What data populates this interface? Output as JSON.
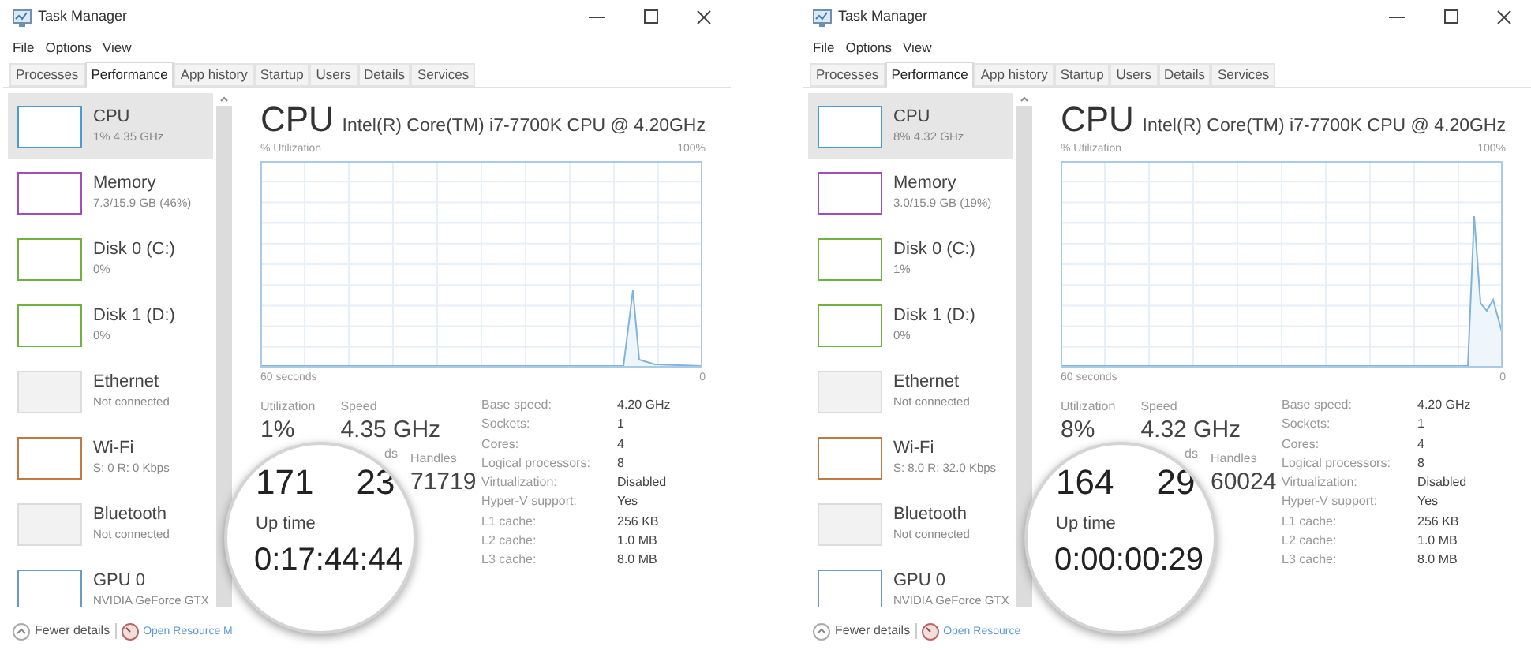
{
  "windows": [
    {
      "title": "Task Manager",
      "menu": [
        "File",
        "Options",
        "View"
      ],
      "tabs": [
        {
          "label": "Processes",
          "selected": false
        },
        {
          "label": "Performance",
          "selected": true
        },
        {
          "label": "App history",
          "selected": false
        },
        {
          "label": "Startup",
          "selected": false
        },
        {
          "label": "Users",
          "selected": false
        },
        {
          "label": "Details",
          "selected": false
        },
        {
          "label": "Services",
          "selected": false
        }
      ],
      "sidebar": [
        {
          "name": "CPU",
          "detail": "1% 4.35 GHz",
          "color": "#4a9ad6",
          "selected": true,
          "connected": true
        },
        {
          "name": "Memory",
          "detail": "7.3/15.9 GB (46%)",
          "color": "#a34db8",
          "selected": false,
          "connected": true
        },
        {
          "name": "Disk 0 (C:)",
          "detail": "0%",
          "color": "#6fb33e",
          "selected": false,
          "connected": true
        },
        {
          "name": "Disk 1 (D:)",
          "detail": "0%",
          "color": "#6fb33e",
          "selected": false,
          "connected": true
        },
        {
          "name": "Ethernet",
          "detail": "Not connected",
          "color": "#dcdcdc",
          "selected": false,
          "connected": false
        },
        {
          "name": "Wi-Fi",
          "detail": "S: 0 R: 0 Kbps",
          "color": "#c07a42",
          "selected": false,
          "connected": true
        },
        {
          "name": "Bluetooth",
          "detail": "Not connected",
          "color": "#dcdcdc",
          "selected": false,
          "connected": false
        },
        {
          "name": "GPU 0",
          "detail": "NVIDIA GeForce GTX",
          "color": "#6a9bc4",
          "selected": false,
          "connected": true
        }
      ],
      "header": {
        "title": "CPU",
        "model": "Intel(R) Core(TM) i7-7700K CPU @ 4.20GHz"
      },
      "graph": {
        "y_label": "% Utilization",
        "y_max": "100%",
        "x_start": "60 seconds",
        "x_end": "0"
      },
      "stats": [
        {
          "label": "Utilization",
          "value": "1%"
        },
        {
          "label": "Speed",
          "value": "4.35 GHz"
        }
      ],
      "threads_label": "ds",
      "handles": {
        "label": "Handles",
        "value": "71719"
      },
      "specs": [
        {
          "label": "Base speed:",
          "value": "4.20 GHz"
        },
        {
          "label": "Sockets:",
          "value": "1"
        },
        {
          "label": "Cores:",
          "value": "4"
        },
        {
          "label": "Logical processors:",
          "value": "8"
        },
        {
          "label": "Virtualization:",
          "value": "Disabled"
        },
        {
          "label": "Hyper-V support:",
          "value": "Yes"
        },
        {
          "label": "L1 cache:",
          "value": "256 KB"
        },
        {
          "label": "L2 cache:",
          "value": "1.0 MB"
        },
        {
          "label": "L3 cache:",
          "value": "8.0 MB"
        }
      ],
      "magnifier": {
        "processes": "171",
        "threads": "23",
        "label": "Up time",
        "value": "0:17:44:44"
      },
      "footer": {
        "fewer_details": "Fewer details",
        "resource_monitor": "Open Resource M"
      }
    },
    {
      "title": "Task Manager",
      "menu": [
        "File",
        "Options",
        "View"
      ],
      "tabs": [
        {
          "label": "Processes",
          "selected": false
        },
        {
          "label": "Performance",
          "selected": true
        },
        {
          "label": "App history",
          "selected": false
        },
        {
          "label": "Startup",
          "selected": false
        },
        {
          "label": "Users",
          "selected": false
        },
        {
          "label": "Details",
          "selected": false
        },
        {
          "label": "Services",
          "selected": false
        }
      ],
      "sidebar": [
        {
          "name": "CPU",
          "detail": "8% 4.32 GHz",
          "color": "#4a9ad6",
          "selected": true,
          "connected": true
        },
        {
          "name": "Memory",
          "detail": "3.0/15.9 GB (19%)",
          "color": "#a34db8",
          "selected": false,
          "connected": true
        },
        {
          "name": "Disk 0 (C:)",
          "detail": "1%",
          "color": "#6fb33e",
          "selected": false,
          "connected": true
        },
        {
          "name": "Disk 1 (D:)",
          "detail": "0%",
          "color": "#6fb33e",
          "selected": false,
          "connected": true
        },
        {
          "name": "Ethernet",
          "detail": "Not connected",
          "color": "#dcdcdc",
          "selected": false,
          "connected": false
        },
        {
          "name": "Wi-Fi",
          "detail": "S: 8.0 R: 32.0 Kbps",
          "color": "#c07a42",
          "selected": false,
          "connected": true
        },
        {
          "name": "Bluetooth",
          "detail": "Not connected",
          "color": "#dcdcdc",
          "selected": false,
          "connected": false
        },
        {
          "name": "GPU 0",
          "detail": "NVIDIA GeForce GTX",
          "color": "#6a9bc4",
          "selected": false,
          "connected": true
        }
      ],
      "header": {
        "title": "CPU",
        "model": "Intel(R) Core(TM) i7-7700K CPU @ 4.20GHz"
      },
      "graph": {
        "y_label": "% Utilization",
        "y_max": "100%",
        "x_start": "60 seconds",
        "x_end": "0"
      },
      "stats": [
        {
          "label": "Utilization",
          "value": "8%"
        },
        {
          "label": "Speed",
          "value": "4.32 GHz"
        }
      ],
      "threads_label": "ds",
      "handles": {
        "label": "Handles",
        "value": "60024"
      },
      "specs": [
        {
          "label": "Base speed:",
          "value": "4.20 GHz"
        },
        {
          "label": "Sockets:",
          "value": "1"
        },
        {
          "label": "Cores:",
          "value": "4"
        },
        {
          "label": "Logical processors:",
          "value": "8"
        },
        {
          "label": "Virtualization:",
          "value": "Disabled"
        },
        {
          "label": "Hyper-V support:",
          "value": "Yes"
        },
        {
          "label": "L1 cache:",
          "value": "256 KB"
        },
        {
          "label": "L2 cache:",
          "value": "1.0 MB"
        },
        {
          "label": "L3 cache:",
          "value": "8.0 MB"
        }
      ],
      "magnifier": {
        "processes": "164",
        "threads": "29",
        "label": "Up time",
        "value": "0:00:00:29"
      },
      "footer": {
        "fewer_details": "Fewer details",
        "resource_monitor": "Open Resource"
      }
    }
  ]
}
